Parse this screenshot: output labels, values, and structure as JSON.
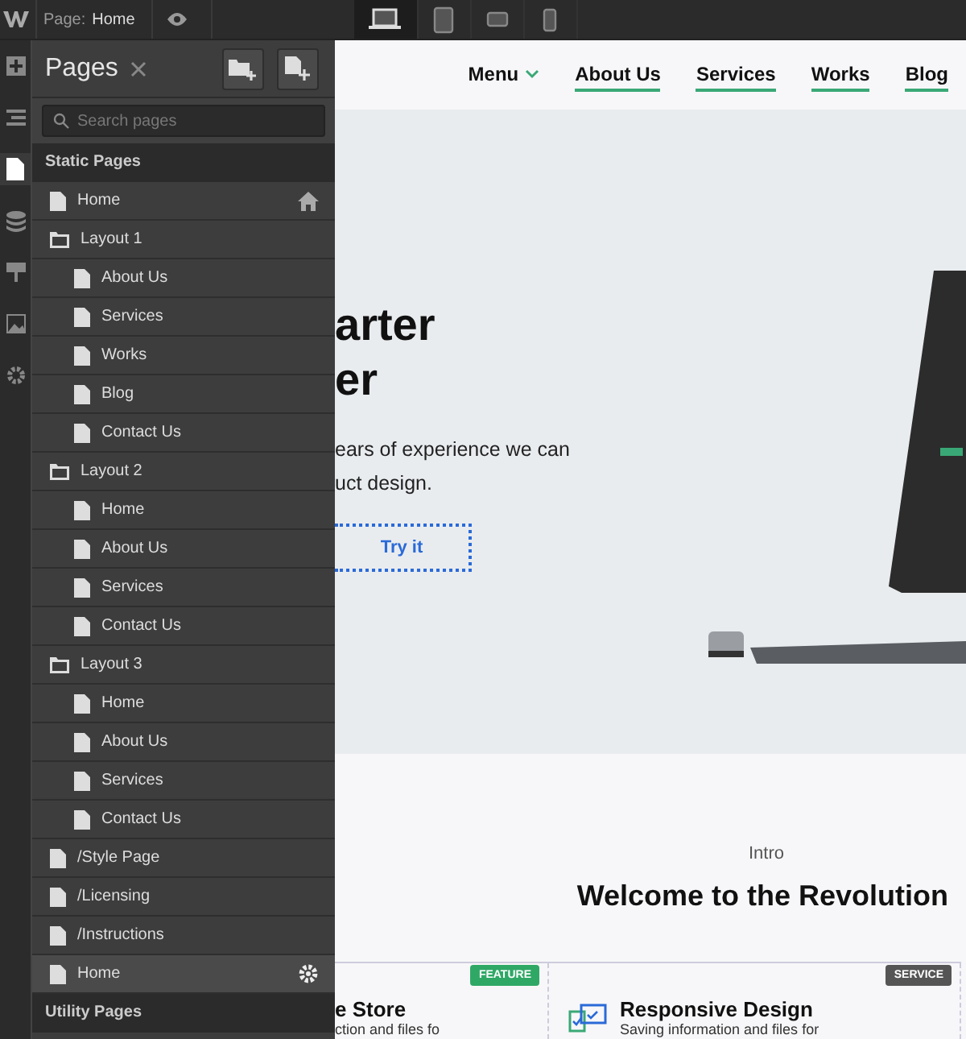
{
  "topbar": {
    "page_label": "Page:",
    "page_name": "Home",
    "devices": [
      {
        "kind": "laptop",
        "selected": true
      },
      {
        "kind": "tablet",
        "selected": false
      },
      {
        "kind": "landscape",
        "selected": false
      },
      {
        "kind": "phone",
        "selected": false
      }
    ]
  },
  "rail": [
    {
      "kind": "add",
      "selected": false
    },
    {
      "kind": "navigator",
      "selected": false
    },
    {
      "kind": "pages",
      "selected": true
    },
    {
      "kind": "cms",
      "selected": false
    },
    {
      "kind": "brush",
      "selected": false
    },
    {
      "kind": "assets",
      "selected": false
    },
    {
      "kind": "settings",
      "selected": false
    }
  ],
  "pages_panel": {
    "title": "Pages",
    "search": {
      "placeholder": "Search pages"
    },
    "sections": [
      {
        "title": "Static Pages",
        "items": [
          {
            "label": "Home",
            "kind": "page",
            "home": true,
            "hovered": false
          },
          {
            "label": "Layout 1",
            "kind": "folder",
            "home": false,
            "hovered": false,
            "children": [
              {
                "label": "About Us"
              },
              {
                "label": "Services"
              },
              {
                "label": "Works"
              },
              {
                "label": "Blog"
              },
              {
                "label": "Contact Us"
              }
            ]
          },
          {
            "label": "Layout 2",
            "kind": "folder",
            "home": false,
            "hovered": false,
            "children": [
              {
                "label": "Home"
              },
              {
                "label": "About Us"
              },
              {
                "label": "Services"
              },
              {
                "label": "Contact Us"
              }
            ]
          },
          {
            "label": "Layout 3",
            "kind": "folder",
            "home": false,
            "hovered": false,
            "children": [
              {
                "label": "Home"
              },
              {
                "label": "About Us"
              },
              {
                "label": "Services"
              },
              {
                "label": "Contact Us"
              }
            ]
          },
          {
            "label": "/Style Page",
            "kind": "page",
            "home": false,
            "hovered": false
          },
          {
            "label": "/Licensing",
            "kind": "page",
            "home": false,
            "hovered": false
          },
          {
            "label": "/Instructions",
            "kind": "page",
            "home": false,
            "hovered": false
          },
          {
            "label": "Home",
            "kind": "page",
            "home": false,
            "hovered": true
          }
        ]
      },
      {
        "title": "Utility Pages"
      }
    ]
  },
  "canvas": {
    "nav": [
      {
        "label": "Menu",
        "kind": "dropdown",
        "underlined": false
      },
      {
        "label": "About Us",
        "kind": "link",
        "underlined": true
      },
      {
        "label": "Services",
        "kind": "link",
        "underlined": true
      },
      {
        "label": "Works",
        "kind": "link",
        "underlined": true
      },
      {
        "label": "Blog",
        "kind": "link",
        "underlined": true
      }
    ],
    "hero": {
      "heading_lines": [
        "arter",
        "er"
      ],
      "paragraph_lines": [
        "ears of experience we can",
        "uct design."
      ],
      "button": "Try it"
    },
    "intro": {
      "eyebrow": "Intro",
      "title": "Welcome to the Revolution"
    },
    "cards": [
      {
        "badge": "FEATURE",
        "color": "#2fa866",
        "title": "e Store",
        "text": "ction and files fo"
      },
      {
        "badge": "SERVICE",
        "color": "#555555",
        "title": "Responsive Design",
        "text": "Saving information and files for"
      }
    ]
  }
}
